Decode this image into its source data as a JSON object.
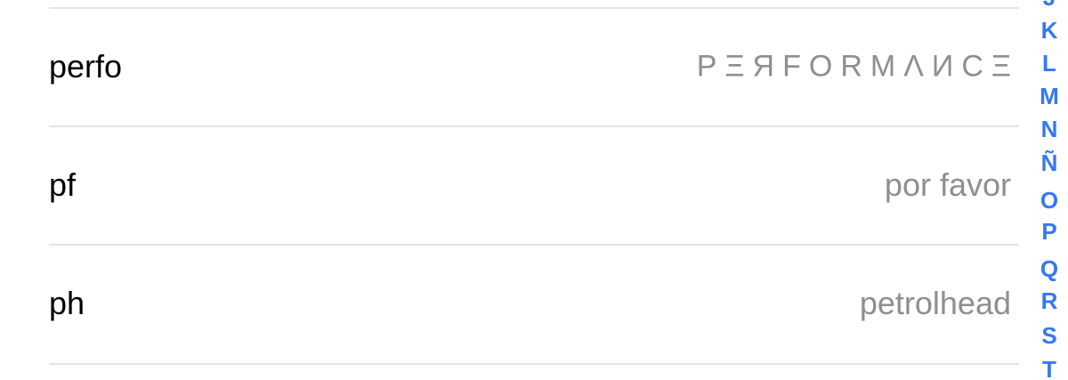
{
  "rows": [
    {
      "shortcut": "perfo",
      "phrase": "PΞЯFORMΛИCΞ"
    },
    {
      "shortcut": "pf",
      "phrase": "por favor"
    },
    {
      "shortcut": "ph",
      "phrase": "petrolhead"
    }
  ],
  "section_index": [
    "J",
    "K",
    "L",
    "M",
    "N",
    "Ñ",
    "O",
    "P",
    "Q",
    "R",
    "S",
    "T"
  ],
  "colors": {
    "index_accent": "#3478f6",
    "phrase_text": "#8e8e93",
    "separator": "#e3e3e8"
  }
}
